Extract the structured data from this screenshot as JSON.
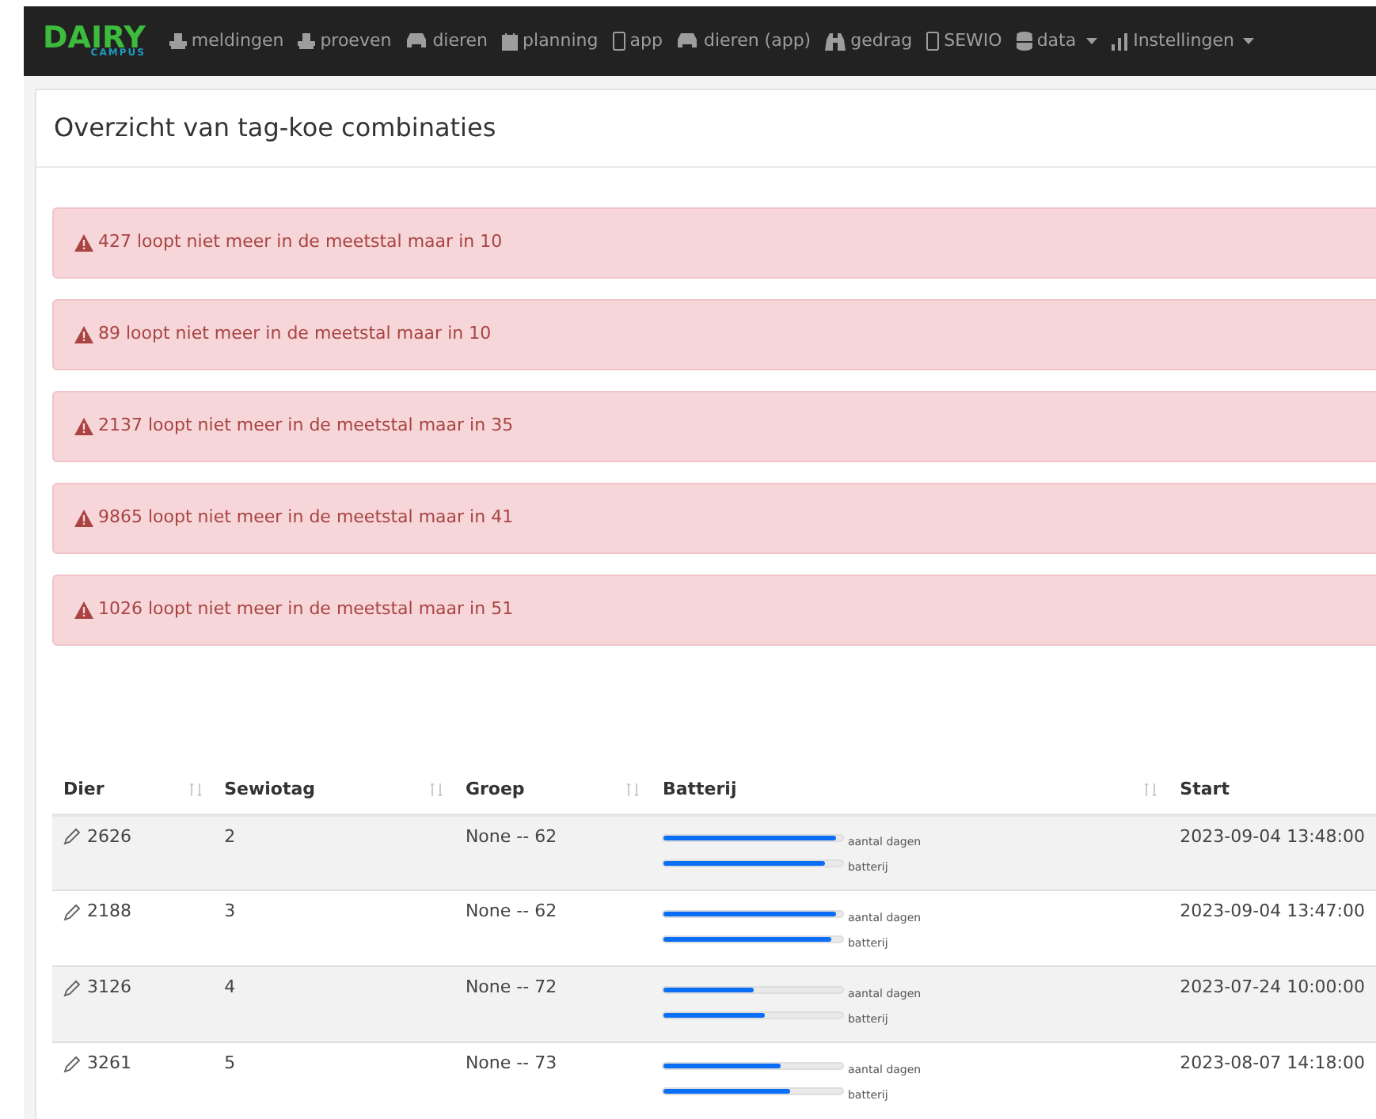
{
  "navbar": {
    "brand": {
      "name": "DAIRY",
      "sub": "CAMPUS"
    },
    "items": [
      {
        "label": "meldingen",
        "dropdown": false
      },
      {
        "label": "proeven",
        "dropdown": false
      },
      {
        "label": "dieren",
        "dropdown": false
      },
      {
        "label": "planning",
        "dropdown": false
      },
      {
        "label": "app",
        "dropdown": false
      },
      {
        "label": "dieren (app)",
        "dropdown": false
      },
      {
        "label": "gedrag",
        "dropdown": false
      },
      {
        "label": "SEWIO",
        "dropdown": false
      },
      {
        "label": "data",
        "dropdown": true
      },
      {
        "label": "Instellingen",
        "dropdown": true
      }
    ]
  },
  "card": {
    "title": "Overzicht van tag-koe combinaties",
    "alerts": [
      "427 loopt niet meer in de meetstal maar in 10",
      "89 loopt niet meer in de meetstal maar in 10",
      "2137 loopt niet meer in de meetstal maar in 35",
      "9865 loopt niet meer in de meetstal maar in 41",
      "1026 loopt niet meer in de meetstal maar in 51"
    ],
    "table": {
      "columns": [
        "Dier",
        "Sewiotag",
        "Groep",
        "Batterij",
        "Start"
      ],
      "rows": [
        {
          "dier": "2626",
          "sewiotag": "2",
          "groep": "None -- 62",
          "bars": [
            {
              "label": "aantal dagen",
              "level": 0.96
            },
            {
              "label": "batterij",
              "level": 0.9
            }
          ],
          "start": "2023-09-04 13:48:00"
        },
        {
          "dier": "2188",
          "sewiotag": "3",
          "groep": "None -- 62",
          "bars": [
            {
              "label": "aantal dagen",
              "level": 0.96
            },
            {
              "label": "batterij",
              "level": 0.93
            }
          ],
          "start": "2023-09-04 13:47:00"
        },
        {
          "dier": "3126",
          "sewiotag": "4",
          "groep": "None -- 72",
          "bars": [
            {
              "label": "aantal dagen",
              "level": 0.5
            },
            {
              "label": "batterij",
              "level": 0.56
            }
          ],
          "start": "2023-07-24 10:00:00"
        },
        {
          "dier": "3261",
          "sewiotag": "5",
          "groep": "None -- 73",
          "bars": [
            {
              "label": "aantal dagen",
              "level": 0.65
            },
            {
              "label": "batterij",
              "level": 0.7
            }
          ],
          "start": "2023-08-07 14:18:00"
        }
      ]
    }
  }
}
